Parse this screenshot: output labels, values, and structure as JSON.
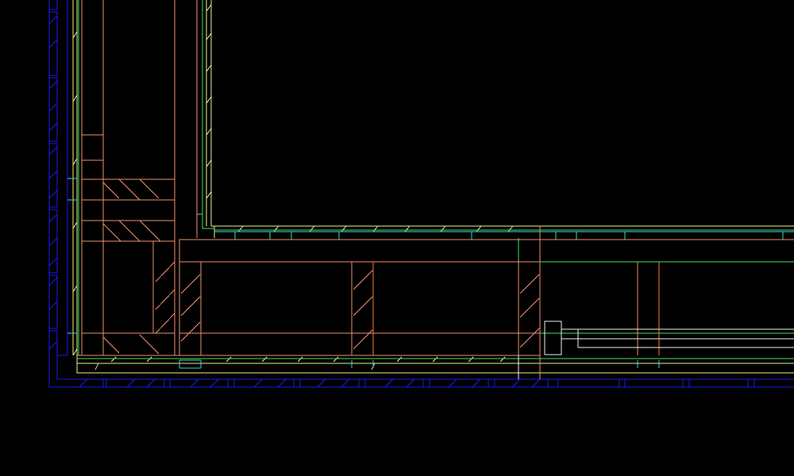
{
  "colors": {
    "background": "#000000",
    "foundation": "#1a1af0",
    "framing": "#f0906c",
    "stud_hot": "#ff7a38",
    "sheathing": "#eef090",
    "green_line": "#44e060",
    "cyan_line": "#38d8e0",
    "white_line": "#f0f0f0"
  },
  "drawing": {
    "kind": "cad-section-detail",
    "visible_text": []
  }
}
